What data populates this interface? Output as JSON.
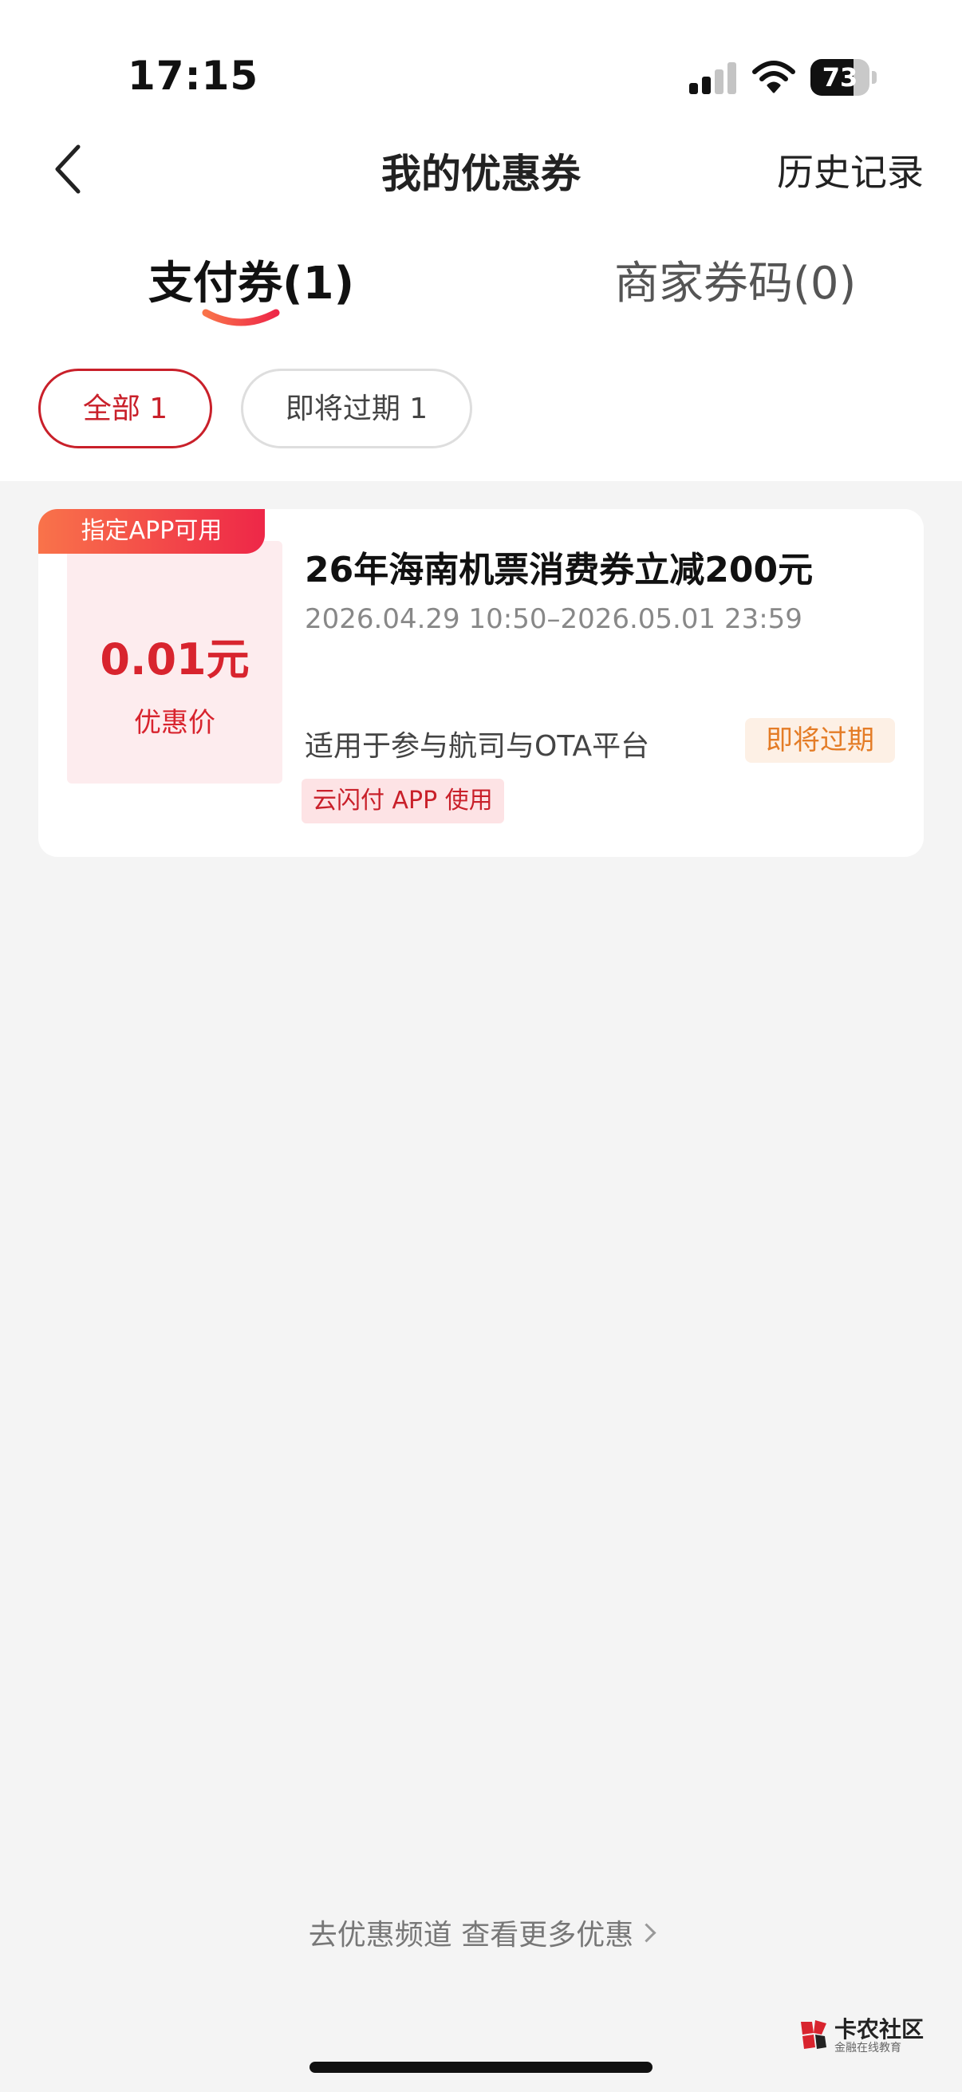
{
  "status_bar": {
    "time": "17:15",
    "battery": "73",
    "battery_level": 0.73
  },
  "header": {
    "title": "我的优惠券",
    "history_label": "历史记录"
  },
  "tabs": [
    {
      "label": "支付券(1)",
      "active": true
    },
    {
      "label": "商家券码(0)",
      "active": false
    }
  ],
  "filters": [
    {
      "label": "全部 1",
      "active": true
    },
    {
      "label": "即将过期 1",
      "active": false
    }
  ],
  "coupon": {
    "ribbon": "指定APP可用",
    "price": "0.01元",
    "price_label": "优惠价",
    "title": "26年海南机票消费券立减200元",
    "period": "2026.04.29 10:50–2026.05.01 23:59",
    "scope": "适用于参与航司与OTA平台",
    "status": "即将过期",
    "tag": "云闪付 APP 使用"
  },
  "footer": {
    "link_label": "去优惠频道 查看更多优惠"
  },
  "watermark": {
    "name": "卡农社区",
    "subtitle": "金融在线教育"
  },
  "colors": {
    "accent": "#c9202a",
    "price": "#d8242e",
    "warning": "#e47c26"
  }
}
